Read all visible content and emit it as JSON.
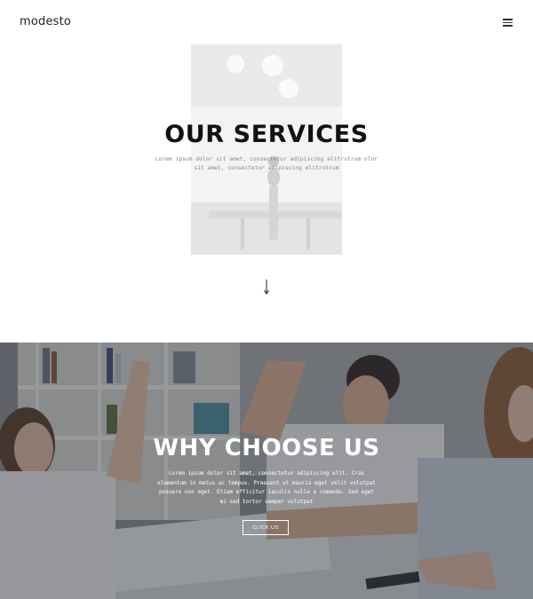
{
  "header": {
    "logo": "modesto",
    "menu_icon": "hamburger-menu-icon"
  },
  "hero": {
    "title": "OUR SERVICES",
    "description": "Lorem ipsum dolor sit amet, consectetur adipiscing elitrutrum olor sit amet, consectetur adipiscing elitrutrum",
    "scroll_icon": "arrow-down-icon"
  },
  "why": {
    "title": "WHY CHOOSE US",
    "description": "Lorem ipsum dolor sit amet, consectetur adipiscing elit. Cras elementum in metus ac tempus. Praesent ut mauris eget velit volutpat posuere non eget. Etiam efficitur iaculis nulla a commodo. Sed eget mi sed tortor semper volutpat",
    "button_label": "CLICK US"
  },
  "colors": {
    "title_dark": "#111111",
    "text_gray": "#888888",
    "overlay": "#3a3f45"
  }
}
